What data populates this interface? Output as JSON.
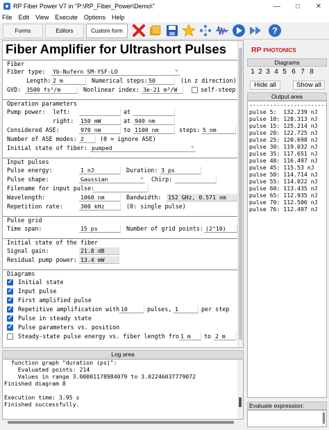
{
  "window": {
    "title": "RP Fiber Power V7 in \"P:\\RP_Fiber_Power\\Demo\\\""
  },
  "menu": {
    "items": [
      "File",
      "Edit",
      "View",
      "Execute",
      "Options",
      "Help"
    ]
  },
  "toolbar": {
    "forms": "Forms",
    "editors": "Editors",
    "custom_form": "Custom form"
  },
  "form": {
    "heading": "Fiber Amplifier for Ultrashort Pulses",
    "fiber": {
      "section": "Fiber",
      "type_label": "Fiber type:",
      "type_value": "Yb-Nufern SM-YSF-LO",
      "length_label": "Length:",
      "length_value": "2 m",
      "steps_label": "Numerical steps:",
      "steps_value": "50",
      "steps_note": "(in z direction)",
      "gvd_label": "GVD:",
      "gvd_value": "3500 fs²/m",
      "nl_label": "Nonlinear index:",
      "nl_value": "3e-21 m²/W",
      "selfsteep_label": "self-steep"
    },
    "operation": {
      "section": "Operation parameters",
      "pump_label": "Pump power:",
      "left_label": "left:",
      "left_value": "",
      "at1": "at",
      "at1_value": "",
      "right_label": "right:",
      "right_value": "150 mW",
      "at2": "at",
      "at2_value": "940 nm",
      "ase_label": "Considered ASE:",
      "ase_from": "970 nm",
      "to_label": "to",
      "ase_to": "1100 nm",
      "asesteps_label": "steps:",
      "asesteps_value": "5 nm",
      "asemodes_label": "Number of ASE modes:",
      "asemodes_value": "2",
      "asemodes_note": "(0 = ignore ASE)",
      "init_label": "Initial state of fiber:",
      "init_value": "pumped"
    },
    "pulses": {
      "section": "Input pulses",
      "energy_label": "Pulse energy:",
      "energy_value": "1 nJ",
      "duration_label": "Duration:",
      "duration_value": "3 ps",
      "shape_label": "Pulse shape:",
      "shape_value": "Gaussian",
      "chirp_label": "Chirp:",
      "chirp_value": "",
      "file_label": "Filename for input pulse:",
      "file_value": "",
      "wl_label": "Wavelength:",
      "wl_value": "1060 nm",
      "bw_label": "Bandwidth:",
      "bw_value": "152 GHz, 0.571 nm",
      "rep_label": "Repetition rate:",
      "rep_value": "300 kHz",
      "rep_note": "(0: single pulse)"
    },
    "grid": {
      "section": "Pulse grid",
      "span_label": "Time span:",
      "span_value": "15 ps",
      "points_label": "Number of grid points:",
      "points_value": "(2^10)"
    },
    "initstate": {
      "section": "Initial state of the fiber",
      "gain_label": "Signal gain:",
      "gain_value": "21.8 dB",
      "resid_label": "Residual pump power:",
      "resid_value": "13.4 mW"
    },
    "diagrams": {
      "section": "Diagrams",
      "items": [
        {
          "label": "Initial state",
          "checked": true
        },
        {
          "label": "Input pulse",
          "checked": true
        },
        {
          "label": "First amplified pulse",
          "checked": true
        },
        {
          "label": "Repetitive amplification with",
          "checked": true
        },
        {
          "label": "Pulse in steady state",
          "checked": true
        },
        {
          "label": "Pulse parameters vs. position",
          "checked": true
        },
        {
          "label": "Steady-state pulse energy vs. fiber length from",
          "checked": false
        }
      ],
      "rep_count": "10",
      "pulses_label": "pulses,",
      "rep_step": "1",
      "per_step_label": "per step",
      "len_from": "1 m",
      "len_to_label": "to",
      "len_to": "2 m"
    }
  },
  "log": {
    "title": "Log area",
    "lines": [
      "  function graph \"duration (ps)\":",
      "    Evaluated points: 214",
      "    Values in range 3.00001178984079 to 3.02246037779072",
      "Finished diagram 8",
      "",
      "Execution time: 3.95 s",
      "Finished successfully."
    ]
  },
  "right": {
    "logo_rp": "RP",
    "logo_photonics": "PHOTONICS",
    "diagrams_title": "Diagrams",
    "diagram_numbers": [
      "1",
      "2",
      "3",
      "4",
      "5",
      "6",
      "7",
      "8"
    ],
    "hide_all": "Hide all",
    "show_all": "Show all",
    "output_title": "Output area",
    "output_lines": [
      "------------------------",
      "pulse 5:  132.239 nJ",
      "pulse 10: 128.313 nJ",
      "pulse 15: 125.214 nJ",
      "pulse 20: 122.725 nJ",
      "pulse 25: 120.698 nJ",
      "pulse 30: 119.032 nJ",
      "pulse 35: 117.651 nJ",
      "pulse 40: 116.497 nJ",
      "pulse 45: 115.53 nJ",
      "pulse 50: 114.714 nJ",
      "pulse 55: 114.022 nJ",
      "pulse 60: 113.435 nJ",
      "pulse 65: 112.935 nJ",
      "pulse 70: 112.506 nJ",
      "pulse 76: 112.497 nJ"
    ],
    "eval_label": "Evaluate expression:"
  },
  "colors": {
    "brand_red": "#d2141c",
    "checkbox_blue": "#1a63c9"
  }
}
